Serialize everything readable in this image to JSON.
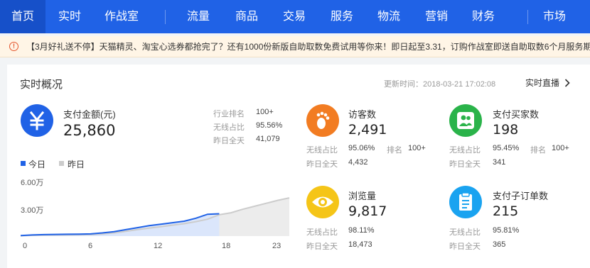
{
  "nav": {
    "items": [
      "首页",
      "实时",
      "作战室",
      "流量",
      "商品",
      "交易",
      "服务",
      "物流",
      "营销",
      "财务",
      "市场"
    ],
    "active": "首页"
  },
  "notice": {
    "text": "【3月好礼送不停】天猫精灵、淘宝心选券都抢完了？还有1000份新版自助取数免费试用等你来！即日起至3.31，订购作战室即送自助取数6个月服务期"
  },
  "realtime": {
    "title": "实时概况",
    "update_time": "更新时间：2018-03-21 17:02:08",
    "live_link": "实时直播",
    "payment": {
      "label": "支付金额(元)",
      "value": "25,860",
      "stats": [
        {
          "label": "行业排名",
          "value": "100+"
        },
        {
          "label": "无线占比",
          "value": "95.56%"
        },
        {
          "label": "昨日全天",
          "value": "41,079"
        }
      ]
    },
    "metrics": {
      "visitors": {
        "label": "访客数",
        "value": "2,491",
        "wireless_label": "无线占比",
        "wireless_value": "95.06%",
        "rank_label": "排名",
        "rank_value": "100+",
        "yesterday_label": "昨日全天",
        "yesterday_value": "4,432",
        "color": "#f27c22",
        "icon": "footprint-icon"
      },
      "buyers": {
        "label": "支付买家数",
        "value": "198",
        "wireless_label": "无线占比",
        "wireless_value": "95.45%",
        "rank_label": "排名",
        "rank_value": "100+",
        "yesterday_label": "昨日全天",
        "yesterday_value": "341",
        "color": "#2ab34a",
        "icon": "users-icon"
      },
      "pageviews": {
        "label": "浏览量",
        "value": "9,817",
        "wireless_label": "无线占比",
        "wireless_value": "98.11%",
        "yesterday_label": "昨日全天",
        "yesterday_value": "18,473",
        "color": "#f5c518",
        "icon": "eye-icon"
      },
      "suborders": {
        "label": "支付子订单数",
        "value": "215",
        "wireless_label": "无线占比",
        "wireless_value": "95.81%",
        "yesterday_label": "昨日全天",
        "yesterday_value": "365",
        "color": "#1aa3f0",
        "icon": "clipboard-icon"
      }
    }
  },
  "chart_data": {
    "type": "area",
    "legend": [
      {
        "name": "今日",
        "color": "#2062e6"
      },
      {
        "name": "昨日",
        "color": "#cccccc"
      }
    ],
    "y_tick_labels": [
      "6.00万",
      "3.00万"
    ],
    "x_tick_labels": [
      "0",
      "6",
      "12",
      "18",
      "23"
    ],
    "ylim": [
      0,
      60000
    ],
    "xlim": [
      0,
      23
    ],
    "series": [
      {
        "name": "今日",
        "x": [
          0,
          1,
          2,
          3,
          4,
          5,
          6,
          7,
          8,
          9,
          10,
          11,
          12,
          13,
          14,
          15,
          16,
          17
        ],
        "values": [
          500,
          1200,
          1500,
          1700,
          1900,
          2000,
          2200,
          3200,
          4500,
          6500,
          8500,
          10500,
          12000,
          13500,
          15000,
          18000,
          22000,
          22500
        ]
      },
      {
        "name": "昨日",
        "x": [
          0,
          1,
          2,
          3,
          4,
          5,
          6,
          7,
          8,
          9,
          10,
          11,
          12,
          13,
          14,
          15,
          16,
          17,
          18,
          19,
          20,
          21,
          22,
          23
        ],
        "values": [
          300,
          800,
          1000,
          1100,
          1200,
          1300,
          1500,
          2200,
          3200,
          4800,
          6500,
          8000,
          9500,
          11000,
          12500,
          14500,
          17000,
          21500,
          23500,
          27000,
          30000,
          33000,
          36000,
          38500
        ]
      }
    ],
    "grid": false,
    "legend_position": "top-left"
  }
}
